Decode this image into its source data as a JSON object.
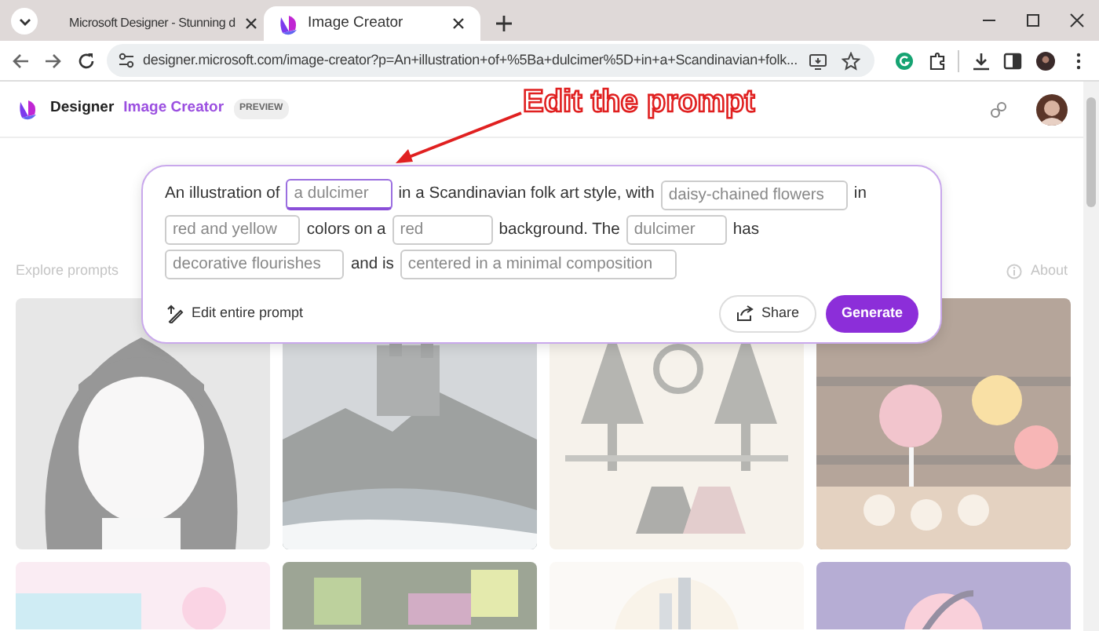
{
  "browser": {
    "tabs": [
      {
        "title": "Microsoft Designer - Stunning d",
        "selected": false
      },
      {
        "title": "Image Creator",
        "selected": true
      }
    ],
    "address": "designer.microsoft.com/image-creator?p=An+illustration+of+%5Ba+dulcimer%5D+in+a+Scandinavian+folk..."
  },
  "header": {
    "brand": "Designer",
    "product": "Image Creator",
    "badge": "PREVIEW"
  },
  "annotation": {
    "text": "Edit the prompt"
  },
  "prompt": {
    "parts": [
      {
        "kind": "text",
        "text": "An illustration of"
      },
      {
        "kind": "field",
        "value": "a dulcimer",
        "focused": true
      },
      {
        "kind": "text",
        "text": "in a Scandinavian folk art style, with"
      },
      {
        "kind": "field",
        "value": "daisy-chained flowers",
        "focused": false
      },
      {
        "kind": "text",
        "text": "in"
      },
      {
        "kind": "field",
        "value": "red and yellow",
        "focused": false
      },
      {
        "kind": "text",
        "text": "colors on a"
      },
      {
        "kind": "field",
        "value": "red",
        "focused": false
      },
      {
        "kind": "text",
        "text": "background. The"
      },
      {
        "kind": "field",
        "value": "dulcimer",
        "focused": false
      },
      {
        "kind": "text",
        "text": "has"
      },
      {
        "kind": "field",
        "value": "decorative flourishes",
        "focused": false
      },
      {
        "kind": "text",
        "text": "and is"
      },
      {
        "kind": "field",
        "value": "centered in a minimal composition",
        "focused": false
      }
    ],
    "edit_link": "Edit entire prompt",
    "share": "Share",
    "generate": "Generate"
  },
  "explore": {
    "title": "Explore prompts",
    "about": "About"
  }
}
